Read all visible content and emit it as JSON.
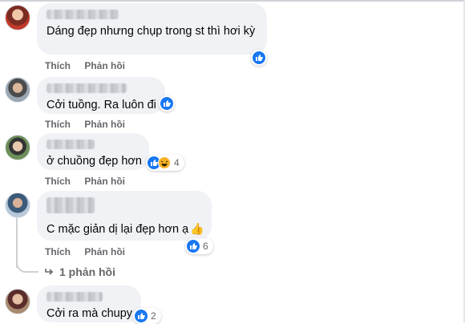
{
  "comments": [
    {
      "text": "Dáng đẹp nhưng chụp trong st thì hơi kỳ",
      "actions": {
        "like": "Thích",
        "reply": "Phản hồi"
      },
      "reactions": {
        "icons": [
          "like-icon"
        ],
        "count": ""
      }
    },
    {
      "text": "Cởi tuồng. Ra luôn đi",
      "actions": {
        "like": "Thích",
        "reply": "Phản hồi"
      },
      "reactions": {
        "icons": [
          "like-icon"
        ],
        "count": ""
      }
    },
    {
      "text": "ở chuồng đẹp hơn",
      "actions": {
        "like": "Thích",
        "reply": "Phản hồi"
      },
      "reactions": {
        "icons": [
          "like-icon",
          "haha-icon"
        ],
        "count": "4"
      }
    },
    {
      "text": "C mặc giản dị lại đẹp hơn ạ",
      "emoji": "👍",
      "actions": {
        "like": "Thích",
        "reply": "Phản hồi"
      },
      "reactions": {
        "icons": [
          "like-icon"
        ],
        "count": "6"
      },
      "replies_label": "1 phản hồi"
    },
    {
      "text": "Cởi ra mà chupy",
      "reactions": {
        "icons": [
          "like-icon"
        ],
        "count": "2"
      }
    }
  ],
  "colors": {
    "bubble": "#f0f2f5",
    "like": "#1877f2",
    "muted": "#65676b"
  }
}
